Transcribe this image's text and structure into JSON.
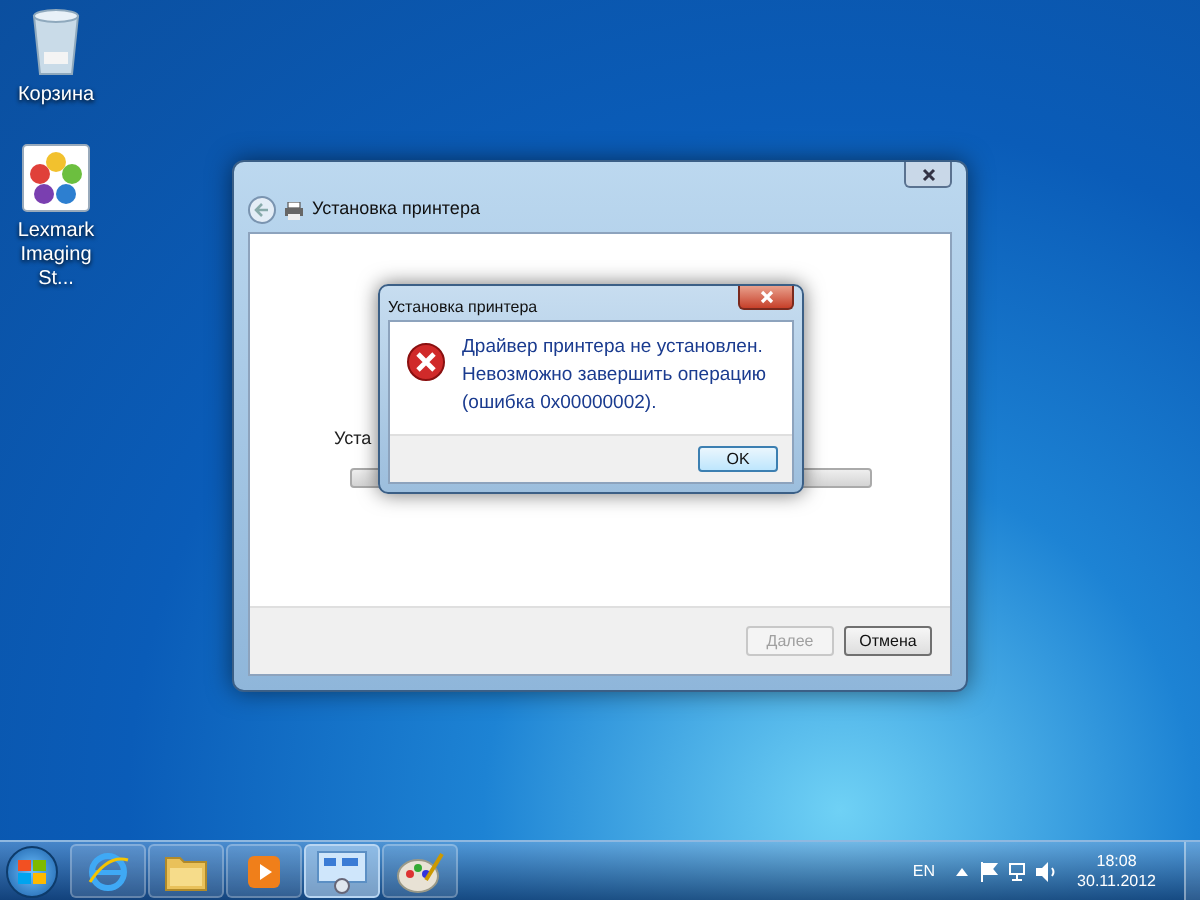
{
  "desktop_icons": [
    {
      "kind": "recycle",
      "label": "Корзина"
    },
    {
      "kind": "app",
      "label": "Lexmark Imaging St..."
    }
  ],
  "main_window": {
    "title": "Установка принтера",
    "partial_text": "Уста",
    "progress": {
      "level": 0
    },
    "buttons": [
      {
        "label": "Далее",
        "disabled": true
      },
      {
        "label": "Отмена",
        "disabled": false
      }
    ]
  },
  "dialog": {
    "title": "Установка принтера",
    "message_lines": [
      "Драйвер принтера не установлен.",
      "Невозможно завершить операцию",
      "(ошибка 0x00000002)."
    ],
    "button": "OK"
  },
  "taskbar": {
    "items": [
      {
        "kind": "browser",
        "selected": false
      },
      {
        "kind": "folder",
        "selected": false
      },
      {
        "kind": "media",
        "selected": false
      },
      {
        "kind": "devices",
        "selected": true
      },
      {
        "kind": "paint",
        "selected": false
      }
    ],
    "language": "EN",
    "time": "18:08",
    "date": "30.11.2012"
  }
}
